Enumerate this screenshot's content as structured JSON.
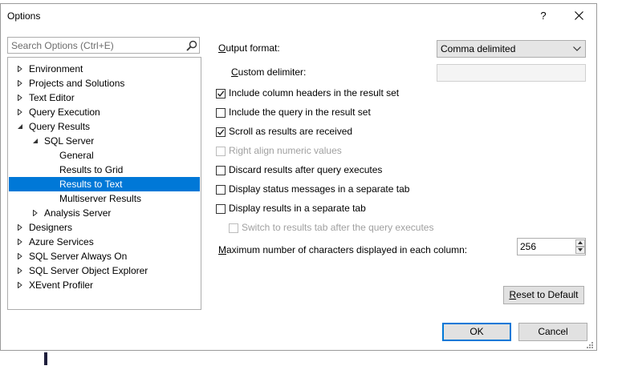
{
  "window": {
    "title": "Options",
    "help_label": "?"
  },
  "search": {
    "placeholder": "Search Options (Ctrl+E)"
  },
  "tree": {
    "items": [
      {
        "label": "Environment",
        "level": 0,
        "expander": "collapsed"
      },
      {
        "label": "Projects and Solutions",
        "level": 0,
        "expander": "collapsed"
      },
      {
        "label": "Text Editor",
        "level": 0,
        "expander": "collapsed"
      },
      {
        "label": "Query Execution",
        "level": 0,
        "expander": "collapsed"
      },
      {
        "label": "Query Results",
        "level": 0,
        "expander": "expanded"
      },
      {
        "label": "SQL Server",
        "level": 1,
        "expander": "expanded"
      },
      {
        "label": "General",
        "level": 2,
        "expander": "none"
      },
      {
        "label": "Results to Grid",
        "level": 2,
        "expander": "none"
      },
      {
        "label": "Results to Text",
        "level": 2,
        "expander": "none",
        "selected": true
      },
      {
        "label": "Multiserver Results",
        "level": 2,
        "expander": "none"
      },
      {
        "label": "Analysis Server",
        "level": 1,
        "expander": "collapsed"
      },
      {
        "label": "Designers",
        "level": 0,
        "expander": "collapsed"
      },
      {
        "label": "Azure Services",
        "level": 0,
        "expander": "collapsed"
      },
      {
        "label": "SQL Server Always On",
        "level": 0,
        "expander": "collapsed"
      },
      {
        "label": "SQL Server Object Explorer",
        "level": 0,
        "expander": "collapsed"
      },
      {
        "label": "XEvent Profiler",
        "level": 0,
        "expander": "collapsed"
      }
    ]
  },
  "options": {
    "output_format": {
      "label": "Output format:",
      "value": "Comma delimited"
    },
    "custom_delimiter": {
      "label": "Custom delimiter:",
      "value": ""
    },
    "checkboxes": [
      {
        "label": "Include column headers in the result set",
        "checked": true,
        "enabled": true
      },
      {
        "label": "Include the query in the result set",
        "checked": false,
        "enabled": true
      },
      {
        "label": "Scroll as results are received",
        "checked": true,
        "enabled": true
      },
      {
        "label": "Right align numeric values",
        "checked": false,
        "enabled": false
      },
      {
        "label": "Discard results after query executes",
        "checked": false,
        "enabled": true
      },
      {
        "label": "Display status messages in a separate tab",
        "checked": false,
        "enabled": true
      },
      {
        "label": "Display results in a separate tab",
        "checked": false,
        "enabled": true
      },
      {
        "label": "Switch to results tab after the query executes",
        "checked": false,
        "enabled": false
      }
    ],
    "max_chars": {
      "label": "Maximum number of characters displayed in each column:",
      "value": "256"
    }
  },
  "buttons": {
    "reset": "Reset to Default",
    "ok": "OK",
    "cancel": "Cancel"
  },
  "colors": {
    "selection": "#0078d7",
    "default_button_border": "#0078d7"
  }
}
